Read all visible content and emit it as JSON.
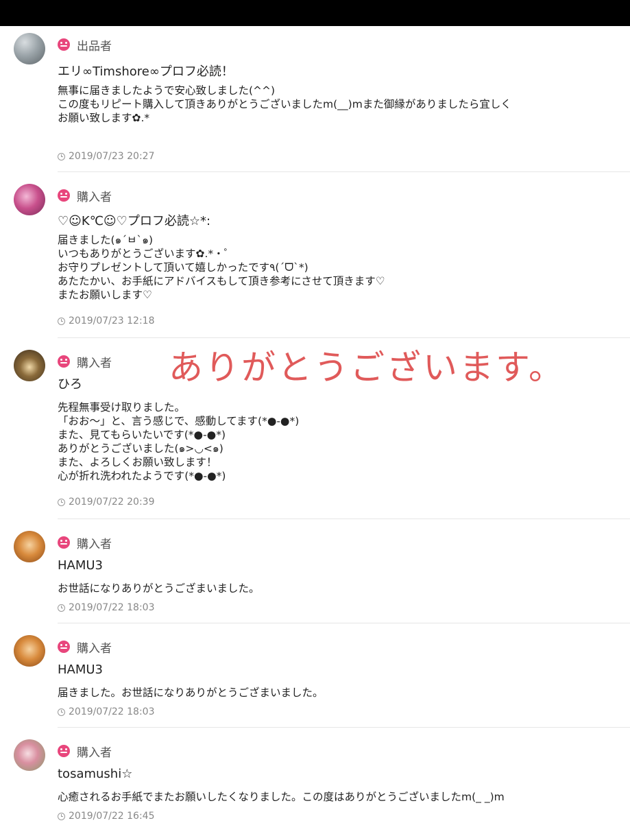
{
  "overlay_text": "ありがとうございます。",
  "reviews": [
    {
      "role": "出品者",
      "username": "エリ∞Timshore∞プロフ必読！",
      "message": [
        "無事に届きましたようで安心致しました(^^)",
        "この度もリピート購入して頂きありがとうございましたm(__)mまた御縁がありましたら宜しく",
        "お願い致します✿.*"
      ],
      "timestamp": "2019/07/23 20:27"
    },
    {
      "role": "購入者",
      "username": "♡☺K℃☺♡プロフ必読☆*:",
      "message": [
        "届きました(๑´ㅂ`๑)",
        "いつもありがとうございます✿.*・゜",
        "お守りプレゼントして頂いて嬉しかったです٩(ˊᗜˋ*)",
        "あたたかい、お手紙にアドバイスもして頂き参考にさせて頂きます♡",
        "またお願いします♡"
      ],
      "timestamp": "2019/07/23 12:18"
    },
    {
      "role": "購入者",
      "username": "ひろ",
      "message": [
        "先程無事受け取りました。",
        "「おお〜」と、言う感じで、感動してます(*●-●*)",
        "また、見てもらいたいです(*●-●*)",
        "ありがとうございました(๑>◡<๑)",
        "また、よろしくお願い致します！",
        "心が折れ洗われたようです(*●-●*)"
      ],
      "timestamp": "2019/07/22 20:39"
    },
    {
      "role": "購入者",
      "username": "HAMU3",
      "message": [
        "お世話になりありがとうござまいました。"
      ],
      "timestamp": "2019/07/22 18:03"
    },
    {
      "role": "購入者",
      "username": "HAMU3",
      "message": [
        "届きました。お世話になりありがとうござまいました。"
      ],
      "timestamp": "2019/07/22 18:03"
    },
    {
      "role": "購入者",
      "username": "tosamushi☆",
      "message": [
        "心癒されるお手紙でまたお願いしたくなりました。この度はありがとうございましたm(_ _)m"
      ],
      "timestamp": "2019/07/22 16:45"
    }
  ]
}
